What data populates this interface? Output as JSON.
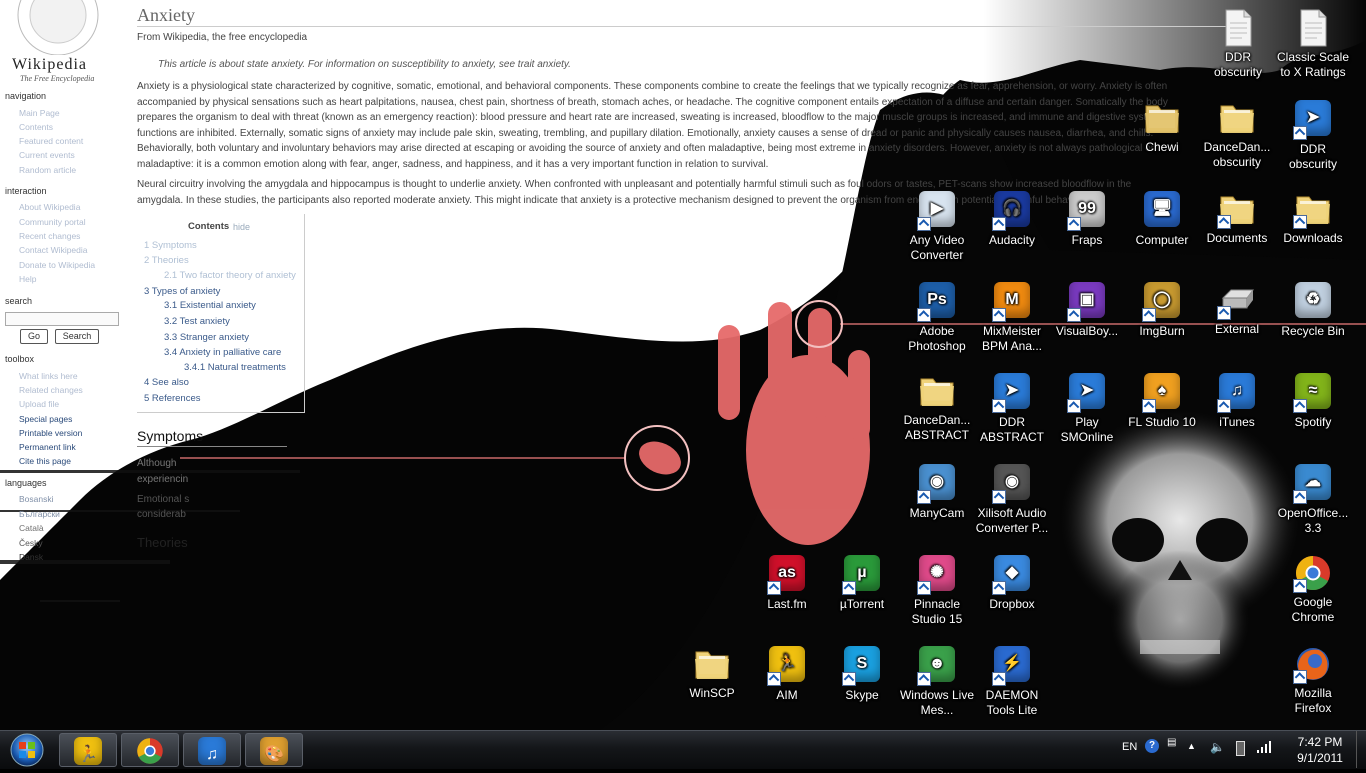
{
  "wikipedia": {
    "logo_text": "Wikipedia",
    "logo_subtitle": "The Free Encyclopedia",
    "title": "Anxiety",
    "subtitle": "From Wikipedia, the free encyclopedia",
    "hatnote": "This article is about state anxiety. For information on susceptibility to anxiety, see trait anxiety.",
    "para1": "Anxiety is a physiological state characterized by cognitive, somatic, emotional, and behavioral components. These components combine to create the feelings that we typically recognize as fear, apprehension, or worry. Anxiety is often accompanied by physical sensations such as heart palpitations, nausea, chest pain, shortness of breath, stomach aches, or headache. The cognitive component entails expectation of a diffuse and certain danger. Somatically the body prepares the organism to deal with threat (known as an emergency reaction): blood pressure and heart rate are increased, sweating is increased, bloodflow to the major muscle groups is increased, and immune and digestive system functions are inhibited. Externally, somatic signs of anxiety may include pale skin, sweating, trembling, and pupillary dilation. Emotionally, anxiety causes a sense of dread or panic and physically causes nausea, diarrhea, and chills. Behaviorally, both voluntary and involuntary behaviors may arise directed at escaping or avoiding the source of anxiety and often maladaptive, being most extreme in anxiety disorders. However, anxiety is not always pathological or maladaptive: it is a common emotion along with fear, anger, sadness, and happiness, and it has a very important function in relation to survival.",
    "para2": "Neural circuitry involving the amygdala and hippocampus is thought to underlie anxiety. When confronted with unpleasant and potentially harmful stimuli such as foul odors or tastes, PET-scans show increased bloodflow in the amygdala. In these studies, the participants also reported moderate anxiety. This might indicate that anxiety is a protective mechanism designed to prevent the organism from engaging in potentially harmful behaviors.",
    "nav_heading": "navigation",
    "nav_items": [
      "Main Page",
      "Contents",
      "Featured content",
      "Current events",
      "Random article"
    ],
    "interaction_heading": "interaction",
    "interaction_items": [
      "About Wikipedia",
      "Community portal",
      "Recent changes",
      "Contact Wikipedia",
      "Donate to Wikipedia",
      "Help"
    ],
    "search_heading": "search",
    "go_button": "Go",
    "search_button": "Search",
    "toolbox_heading": "toolbox",
    "toolbox_items": [
      "What links here",
      "Related changes",
      "Upload file",
      "Special pages",
      "Printable version",
      "Permanent link",
      "Cite this page"
    ],
    "languages_heading": "languages",
    "language_items": [
      "Bosanski",
      "Български",
      "Català",
      "Česky",
      "Dansk"
    ],
    "toc_title": "Contents",
    "toc_hide": "hide",
    "toc_items": [
      "1 Symptoms",
      "2 Theories",
      "2.1 Two factor theory of anxiety",
      "3 Types of anxiety",
      "3.1 Existential anxiety",
      "3.2 Test anxiety",
      "3.3 Stranger anxiety",
      "3.4 Anxiety in palliative care",
      "3.4.1 Natural treatments",
      "4 See also",
      "5 References"
    ],
    "section_symptoms": "Symptoms",
    "sym_line1": "Although",
    "sym_line2": "experiencin",
    "sym_line3": "Emotional s",
    "sym_line4": "considerab",
    "sym_line5": "Theories"
  },
  "desktop_icons": [
    {
      "label": "DDR obscurity",
      "icon": "document-icon",
      "color": "#e8e8e8",
      "shortcut": false
    },
    {
      "label": "Classic Scale to X Ratings",
      "icon": "document-icon",
      "color": "#e8e8e8",
      "shortcut": false
    },
    {
      "label": "Chewi",
      "icon": "user-folder-icon",
      "color": "#e2c26a",
      "shortcut": false
    },
    {
      "label": "DanceDan... obscurity",
      "icon": "folder-icon",
      "color": "#efd27a",
      "shortcut": false
    },
    {
      "label": "DDR obscurity",
      "icon": "ddr-arrow-icon",
      "color": "#2a7bd8",
      "shortcut": true
    },
    {
      "label": "Any Video Converter",
      "icon": "video-converter-icon",
      "color": "#d8e4f0",
      "shortcut": true
    },
    {
      "label": "Audacity",
      "icon": "audacity-icon",
      "color": "#1a3aa0",
      "shortcut": true
    },
    {
      "label": "Fraps",
      "icon": "fraps-icon",
      "color": "#cccccc",
      "shortcut": true
    },
    {
      "label": "Computer",
      "icon": "computer-icon",
      "color": "#2a6ad0",
      "shortcut": false
    },
    {
      "label": "Documents",
      "icon": "documents-folder-icon",
      "color": "#efd27a",
      "shortcut": true
    },
    {
      "label": "Downloads",
      "icon": "downloads-folder-icon",
      "color": "#efd27a",
      "shortcut": true
    },
    {
      "label": "Adobe Photoshop",
      "icon": "photoshop-icon",
      "color": "#1d5ea8",
      "shortcut": true
    },
    {
      "label": "MixMeister BPM Ana...",
      "icon": "mixmeister-icon",
      "color": "#f08a10",
      "shortcut": true
    },
    {
      "label": "VisualBoy...",
      "icon": "visualboy-icon",
      "color": "#7a3ac0",
      "shortcut": true
    },
    {
      "label": "ImgBurn",
      "icon": "imgburn-icon",
      "color": "#c89a30",
      "shortcut": true
    },
    {
      "label": "External",
      "icon": "drive-icon",
      "color": "#bbbbbb",
      "shortcut": true
    },
    {
      "label": "Recycle Bin",
      "icon": "recycle-bin-icon",
      "color": "#c0d0e0",
      "shortcut": false
    },
    {
      "label": "DanceDan... ABSTRACT",
      "icon": "folder-icon",
      "color": "#efd27a",
      "shortcut": false
    },
    {
      "label": "DDR ABSTRACT",
      "icon": "ddr-arrow-icon",
      "color": "#2a7bd8",
      "shortcut": true
    },
    {
      "label": "Play SMOnline",
      "icon": "ddr-arrow-icon",
      "color": "#2a7bd8",
      "shortcut": true
    },
    {
      "label": "FL Studio 10",
      "icon": "fl-studio-icon",
      "color": "#f0a020",
      "shortcut": true
    },
    {
      "label": "iTunes",
      "icon": "itunes-icon",
      "color": "#2a7ad8",
      "shortcut": true
    },
    {
      "label": "Spotify",
      "icon": "spotify-icon",
      "color": "#82b41a",
      "shortcut": true
    },
    {
      "label": "ManyCam",
      "icon": "manycam-icon",
      "color": "#4a90d0",
      "shortcut": true
    },
    {
      "label": "Xilisoft Audio Converter P...",
      "icon": "xilisoft-icon",
      "color": "#555555",
      "shortcut": true
    },
    {
      "label": "OpenOffice... 3.3",
      "icon": "openoffice-icon",
      "color": "#3a8ad0",
      "shortcut": true
    },
    {
      "label": "Last.fm",
      "icon": "lastfm-icon",
      "color": "#d0102a",
      "shortcut": true
    },
    {
      "label": "µTorrent",
      "icon": "utorrent-icon",
      "color": "#2a9a3a",
      "shortcut": true
    },
    {
      "label": "Pinnacle Studio 15",
      "icon": "pinnacle-icon",
      "color": "#e04a8a",
      "shortcut": true
    },
    {
      "label": "Dropbox",
      "icon": "dropbox-icon",
      "color": "#3a8ae0",
      "shortcut": true
    },
    {
      "label": "Google Chrome",
      "icon": "chrome-icon",
      "color": "#d03a2a",
      "shortcut": true
    },
    {
      "label": "WinSCP",
      "icon": "folder-icon",
      "color": "#efd27a",
      "shortcut": false
    },
    {
      "label": "AIM",
      "icon": "aim-icon",
      "color": "#f0c010",
      "shortcut": true
    },
    {
      "label": "Skype",
      "icon": "skype-icon",
      "color": "#1aa0e0",
      "shortcut": true
    },
    {
      "label": "Windows Live Mes...",
      "icon": "messenger-icon",
      "color": "#3aa04a",
      "shortcut": true
    },
    {
      "label": "DAEMON Tools Lite",
      "icon": "daemon-tools-icon",
      "color": "#2a6ad0",
      "shortcut": true
    },
    {
      "label": "Mozilla Firefox",
      "icon": "firefox-icon",
      "color": "#e06a1a",
      "shortcut": true
    }
  ],
  "taskbar": {
    "start_icon": "windows-start-icon",
    "pinned": [
      {
        "name": "aim",
        "icon": "aim-icon",
        "color": "#f0c010"
      },
      {
        "name": "chrome",
        "icon": "chrome-icon",
        "color": "#d03a2a"
      },
      {
        "name": "itunes",
        "icon": "itunes-icon",
        "color": "#2a7ad8"
      },
      {
        "name": "paint",
        "icon": "paint-icon",
        "color": "#e0a030"
      }
    ],
    "language": "EN",
    "time": "7:42 PM",
    "date": "9/1/2011"
  }
}
